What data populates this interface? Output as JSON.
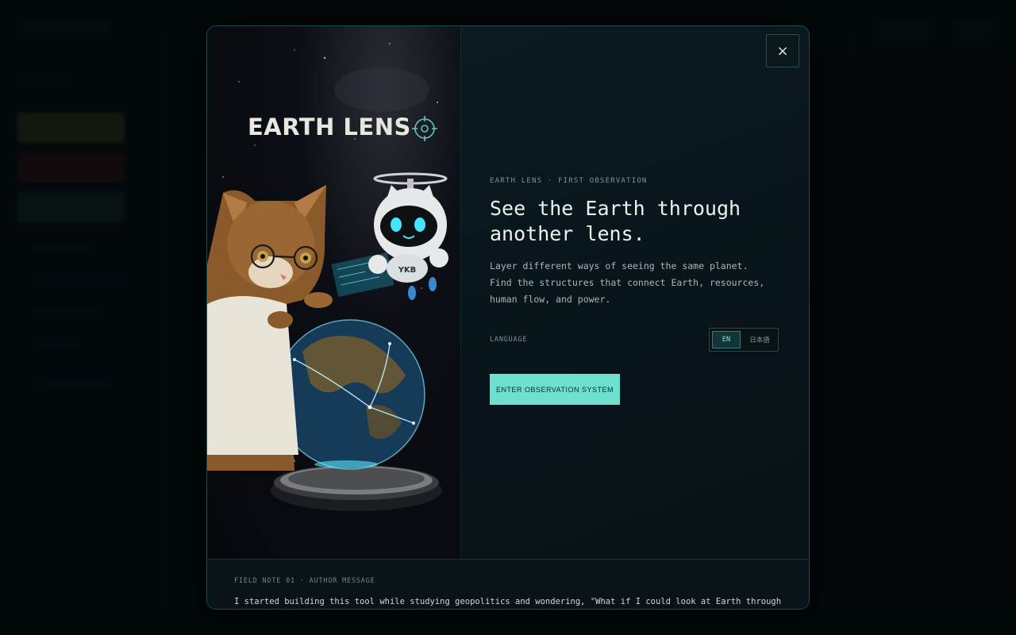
{
  "modal": {
    "brand": "EARTH LENS",
    "close_label": "×",
    "eyebrow": "EARTH LENS · FIRST OBSERVATION",
    "headline": "See the Earth through\nanother lens.",
    "description": "Layer different ways of seeing the same planet. Find the structures that connect Earth, resources, human flow, and power.",
    "language_label": "LANGUAGE",
    "language_options": [
      "EN",
      "日本語"
    ],
    "language_selected": "EN",
    "cta_label": "ENTER OBSERVATION SYSTEM",
    "robot_badge": "YKB"
  },
  "field_note": {
    "label": "FIELD NOTE 01 · AUTHOR MESSAGE",
    "text": "I started building this tool while studying geopolitics and wondering, \"What if I could look at Earth through"
  },
  "colors": {
    "accent": "#6ee0cf",
    "modal_border": "#1f4a4a",
    "background": "#050b0e"
  }
}
